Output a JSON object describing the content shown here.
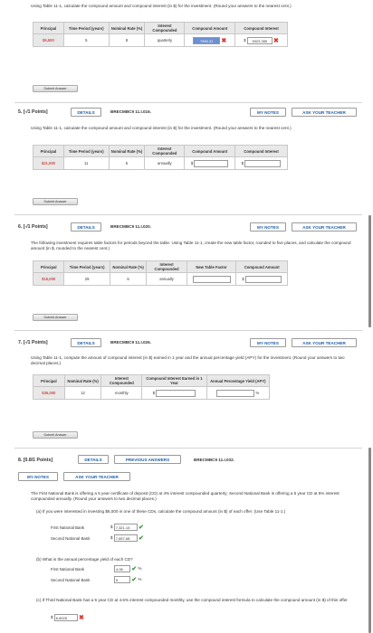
{
  "q4": {
    "instructions": "Using Table 11-1, calculate the compound amount and compound interest (in $) for the investment. (Round your answers to the nearest cent.)",
    "headers": [
      "Principal",
      "Time Period (years)",
      "Nominal Rate (%)",
      "Interest Compounded",
      "Compound Amount",
      "Compound Interest"
    ],
    "principal": "$5,500",
    "time": "5",
    "rate": "8",
    "compounded": "quarterly",
    "amount_value": "7550.31",
    "interest_value": "5023.355",
    "submit_label": "Submit Answer"
  },
  "q5": {
    "number": "5.",
    "points": "[-/1 Points]",
    "details_label": "DETAILS",
    "code": "BRECMBC9 11.I.016.",
    "my_notes_label": "MY NOTES",
    "ask_teacher_label": "ASK YOUR TEACHER",
    "instructions": "Using Table 11-1, calculate the compound amount and compound interest (in $) for the investment. (Round your answers to the nearest cent.)",
    "headers": [
      "Principal",
      "Time Period (years)",
      "Nominal Rate (%)",
      "Interest Compounded",
      "Compound Amount",
      "Compound Interest"
    ],
    "principal": "$21,000",
    "time": "11",
    "rate": "5",
    "compounded": "annually",
    "submit_label": "Submit Answer"
  },
  "q6": {
    "number": "6.",
    "points": "[-/1 Points]",
    "details_label": "DETAILS",
    "code": "BRECMBC9 11.I.020.",
    "my_notes_label": "MY NOTES",
    "ask_teacher_label": "ASK YOUR TEACHER",
    "instructions": "The following investment requires table factors for periods beyond the table. Using Table 11-1, create the new table factor, rounded to five places, and calculate the compound amount (in $, rounded to the nearest cent.)",
    "headers": [
      "Principal",
      "Time Period (years)",
      "Nominal Rate (%)",
      "Interest Compounded",
      "New Table Factor",
      "Compound Amount"
    ],
    "principal": "$15,000",
    "time": "29",
    "rate": "6",
    "compounded": "annually",
    "submit_label": "Submit Answer"
  },
  "q7": {
    "number": "7.",
    "points": "[-/1 Points]",
    "details_label": "DETAILS",
    "code": "BRECMBC9 11.I.026.",
    "my_notes_label": "MY NOTES",
    "ask_teacher_label": "ASK YOUR TEACHER",
    "instructions": "Using Table 11-1, compute the amount of compound interest (in $) earned in 1 year and the annual percentage yield (APY) for the investment. (Round your answers to two decimal places.)",
    "headers": [
      "Principal",
      "Nominal Rate (%)",
      "Interest Compounded",
      "Compound Interest Earned in 1 Year",
      "Annual Percentage Yield (APY)"
    ],
    "principal": "$35,000",
    "rate": "12",
    "compounded": "monthly",
    "percent_suffix": "%",
    "submit_label": "Submit Answer"
  },
  "q8": {
    "number": "8.",
    "points": "[0.8/1 Points]",
    "details_label": "DETAILS",
    "previous_label": "PREVIOUS ANSWERS",
    "code": "BRECMBC9 11.I.032.",
    "my_notes_label": "MY NOTES",
    "ask_teacher_label": "ASK YOUR TEACHER",
    "intro": "The First National Bank is offering a 5 year certificate of deposit (CD) at 4% interest compounded quarterly; Second National Bank is offering a 5 year CD at 5% interest compounded annually. (Round your answers to two decimal places.)",
    "part_a": "(a)  If you were interested in investing $6,000 in one of these CDs, calculate the compound amount (in $) of each offer. (Use Table 11-1.)",
    "first_bank_label": "First National Bank",
    "first_bank_value": "7,321.14",
    "second_bank_label": "Second National Bank",
    "second_bank_value": "7,657.68",
    "part_b": "(b)  What is the annual percentage yield of each CD?",
    "first_apy_value": "4.06",
    "second_apy_value": "5",
    "percent_suffix": "%",
    "part_c": "(c)  If Third National Bank has a 5 year CD at 4.5% interest compounded monthly, use the compound interest formula to calculate the compound amount (in $) of this offer.",
    "third_value": "6.6025",
    "dollar": "$"
  },
  "colors": {
    "link_blue": "#1f5fa8",
    "error_red": "#d9382f",
    "ok_green": "#3a9a3a",
    "principal_red": "#c8504a"
  }
}
